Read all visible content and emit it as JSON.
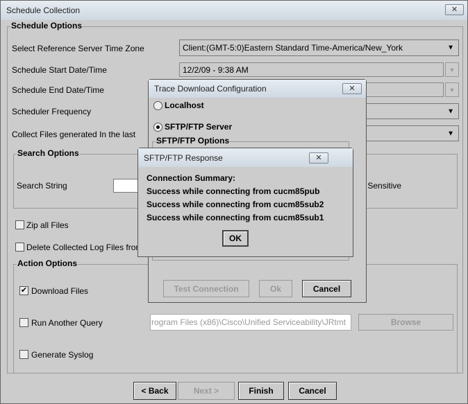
{
  "window": {
    "title": "Schedule Collection",
    "close": "✕"
  },
  "schedule_options": {
    "title": "Schedule Options",
    "time_zone_label": "Select Reference Server Time Zone",
    "time_zone_value": "Client:(GMT-5:0)Eastern Standard Time-America/New_York",
    "start_label": "Schedule Start Date/Time",
    "start_value": "12/2/09 - 9:38 AM",
    "end_label": "Schedule End Date/Time",
    "frequency_label": "Scheduler Frequency",
    "collect_label": "Collect Files generated In the last"
  },
  "search_options": {
    "title": "Search Options",
    "search_label": "Search String",
    "case_sensitive_label": "Case Sensitive"
  },
  "zip_label": "Zip all Files",
  "delete_label": "Delete Collected Log Files from Server",
  "action_options": {
    "title": "Action Options",
    "download_label": "Download Files",
    "download_checked": true,
    "run_query_label": "Run Another Query",
    "run_query_path": "rogram Files (x86)\\Cisco\\Unified Serviceability\\JRtmt",
    "browse": "Browse",
    "syslog_label": "Generate Syslog"
  },
  "footer": {
    "back": "< Back",
    "next": "Next >",
    "finish": "Finish",
    "cancel": "Cancel"
  },
  "trace_dialog": {
    "title": "Trace Download Configuration",
    "localhost": "Localhost",
    "sftp_server": "SFTP/FTP Server",
    "selected": "SFTP/FTP Server",
    "options_title": "SFTP/FTP Options",
    "test_connection": "Test Connection",
    "ok": "Ok",
    "cancel": "Cancel"
  },
  "response_dialog": {
    "title": "SFTP/FTP Response",
    "lines": [
      "Connection Summary:",
      "Success while connecting from cucm85pub",
      "Success while connecting from cucm85sub2",
      "Success while connecting from cucm85sub1"
    ],
    "ok": "OK"
  },
  "arrow_glyph": "▼"
}
